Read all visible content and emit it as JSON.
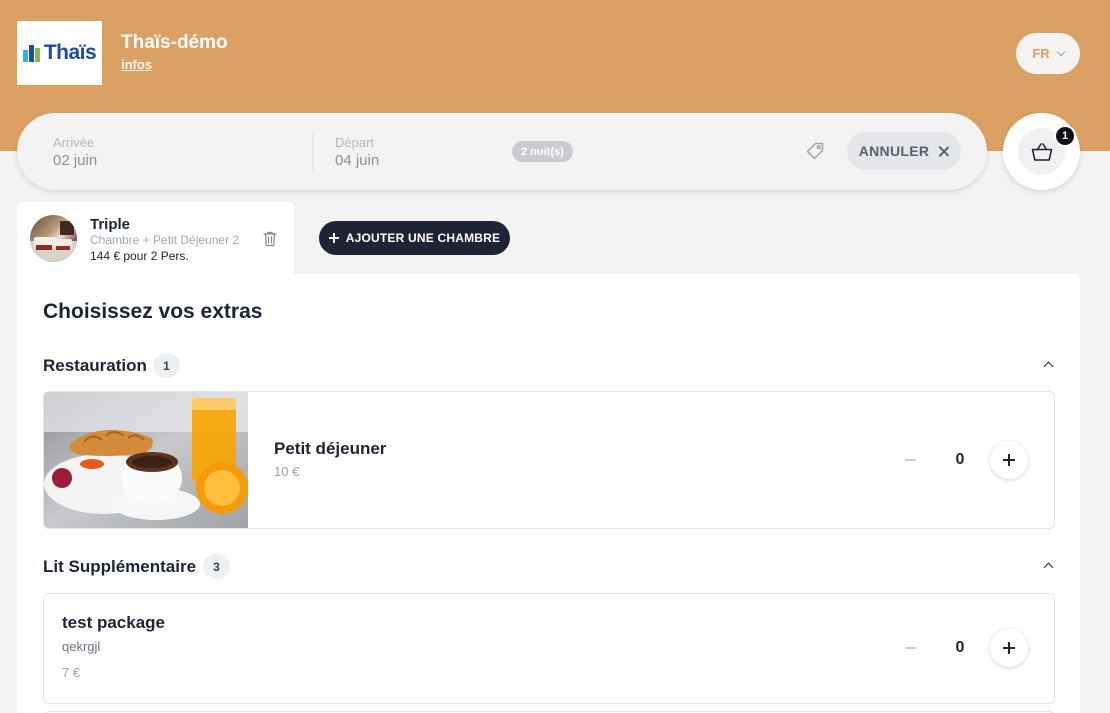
{
  "header": {
    "logo_text": "Thaïs",
    "hotel_name": "Thaïs-démo",
    "info_link": "infos",
    "language": "FR"
  },
  "search": {
    "arrival_label": "Arrivée",
    "arrival_value": "02 juin",
    "departure_label": "Départ",
    "departure_value": "04 juin",
    "nights": "2 nuit(s)",
    "cancel_label": "ANNULER"
  },
  "cart": {
    "count": "1"
  },
  "room": {
    "title": "Triple",
    "subtitle": "Chambre + Petit Déjeuner 2",
    "price": "144 € pour 2 Pers."
  },
  "add_room_label": "AJOUTER UNE CHAMBRE",
  "extras": {
    "title": "Choisissez vos extras",
    "categories": [
      {
        "name": "Restauration",
        "count": "1",
        "items": [
          {
            "name": "Petit déjeuner",
            "price": "10 €",
            "quantity": "0"
          }
        ]
      },
      {
        "name": "Lit Supplémentaire",
        "count": "3",
        "items": [
          {
            "name": "test package",
            "description": "qekrgjl",
            "price": "7 €",
            "quantity": "0"
          }
        ]
      }
    ]
  },
  "colors": {
    "accent": "#dba164",
    "dark": "#1d2433",
    "background": "#f3f3f3"
  }
}
